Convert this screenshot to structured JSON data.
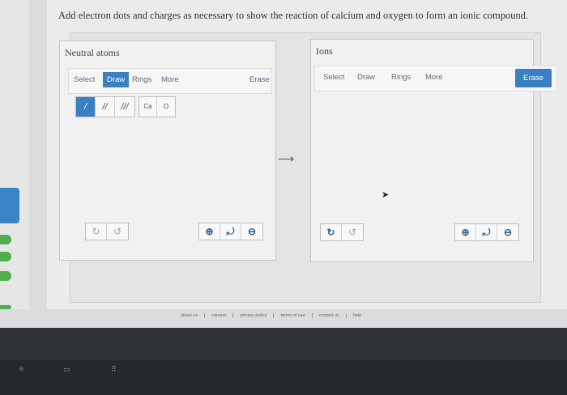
{
  "question": "Add electron dots and charges as necessary to show the reaction of calcium and oxygen to form an ionic compound.",
  "left_panel": {
    "title": "Neutral atoms",
    "toolbar": {
      "select": "Select",
      "draw": "Draw",
      "rings": "Rings",
      "more": "More",
      "erase": "Erase"
    },
    "bonds": [
      "/",
      "//",
      "///"
    ],
    "atoms": [
      "Ca",
      "O"
    ]
  },
  "right_panel": {
    "title": "Ions",
    "toolbar": {
      "select": "Select",
      "draw": "Draw",
      "rings": "Rings",
      "more": "More",
      "erase": "Erase"
    }
  },
  "arrow": "⟶",
  "footer": {
    "about": "about us",
    "careers": "careers",
    "privacy": "privacy policy",
    "terms": "terms of use",
    "contact": "contact us",
    "help": "help"
  },
  "colors": {
    "accent": "#3a7fc1",
    "panel_bg": "#f1f1f1"
  },
  "icons": {
    "undo": "undo-icon",
    "redo": "redo-icon",
    "zoom_in": "zoom-in-icon",
    "reset": "reset-zoom-icon",
    "zoom_out": "zoom-out-icon"
  }
}
